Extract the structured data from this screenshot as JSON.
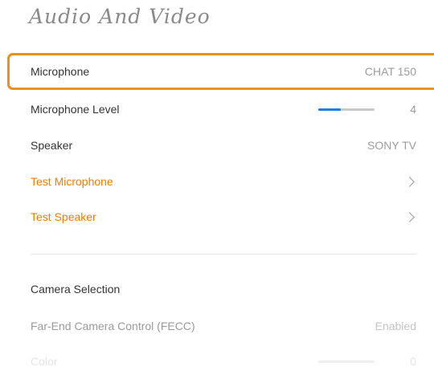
{
  "header": {
    "title": "Audio And Video"
  },
  "rows": {
    "microphone": {
      "label": "Microphone",
      "value": "CHAT 150"
    },
    "mic_level": {
      "label": "Microphone Level",
      "value": "4",
      "level": 0.4
    },
    "speaker": {
      "label": "Speaker",
      "value": "SONY TV"
    },
    "test_mic": {
      "label": "Test Microphone"
    },
    "test_speaker": {
      "label": "Test Speaker"
    },
    "camera_selection": {
      "label": "Camera Selection"
    },
    "fecc": {
      "label": "Far-End Camera Control (FECC)",
      "value": "Enabled"
    },
    "color": {
      "label": "Color",
      "value": "0",
      "level": 0
    }
  },
  "colors": {
    "accent": "#f07d00",
    "focus": "#f28c1a",
    "slider_fill": "#1e7fe0"
  }
}
